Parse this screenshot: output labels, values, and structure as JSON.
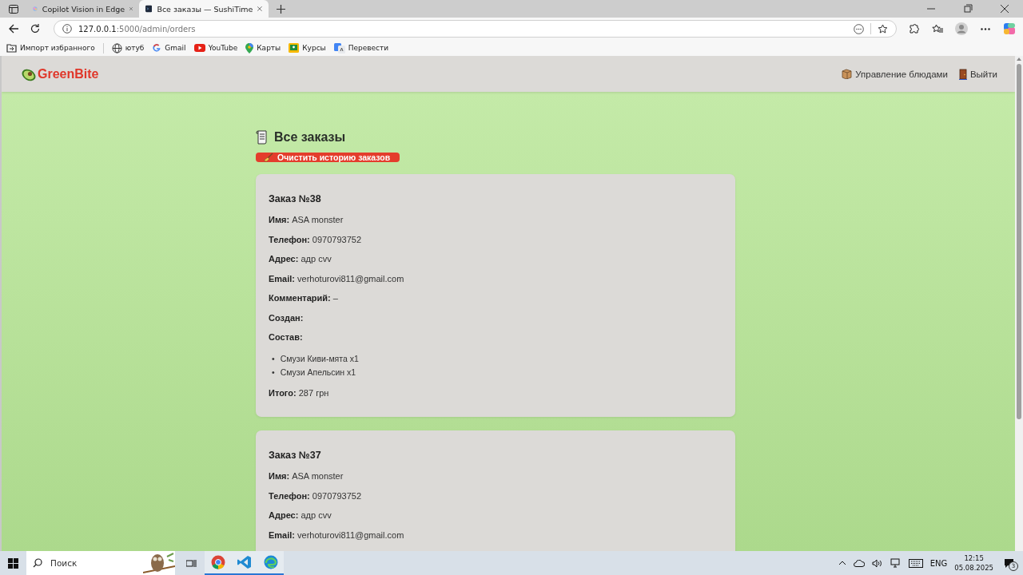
{
  "browser": {
    "tabs": [
      {
        "title": "Copilot Vision in Edge",
        "selected": false
      },
      {
        "title": "Все заказы — SushiTime",
        "selected": true
      }
    ],
    "address": {
      "host": "127.0.0.1",
      "path": ":5000/admin/orders"
    },
    "bookmarks": [
      {
        "label": "Импорт избранного",
        "kind": "import"
      },
      {
        "label": "ютуб",
        "kind": "globe"
      },
      {
        "label": "Gmail",
        "kind": "google"
      },
      {
        "label": "YouTube",
        "kind": "youtube"
      },
      {
        "label": "Карты",
        "kind": "maps"
      },
      {
        "label": "Курсы",
        "kind": "courses"
      },
      {
        "label": "Перевести",
        "kind": "translate"
      }
    ]
  },
  "site": {
    "logo": "GreenBite",
    "nav": [
      {
        "label": "Управление блюдами",
        "kind": "dishes"
      },
      {
        "label": "Выйти",
        "kind": "logout"
      }
    ]
  },
  "page": {
    "title": "Все заказы",
    "clear_button": "Очистить историю заказов",
    "orders": [
      {
        "title": "Заказ №38",
        "fields": [
          {
            "label": "Имя:",
            "value": "ASA monster"
          },
          {
            "label": "Телефон:",
            "value": "0970793752"
          },
          {
            "label": "Адрес:",
            "value": "адр cvv"
          },
          {
            "label": "Email:",
            "value": "verhoturovi811@gmail.com"
          },
          {
            "label": "Комментарий:",
            "value": "–"
          },
          {
            "label": "Создан:"
          }
        ],
        "composition_label": "Состав:",
        "items": [
          {
            "marker": "•",
            "text": "Смузи Киви-мята x1"
          },
          {
            "marker": "•",
            "text": "Смузи Апельсин x1"
          }
        ],
        "total": {
          "label": "Итого:",
          "value": "287 грн"
        }
      },
      {
        "title": "Заказ №37",
        "fields": [
          {
            "label": "Имя:",
            "value": "ASA monster"
          },
          {
            "label": "Телефон:",
            "value": "0970793752"
          },
          {
            "label": "Адрес:",
            "value": "адр cvv"
          },
          {
            "label": "Email:",
            "value": "verhoturovi811@gmail.com"
          }
        ]
      }
    ]
  },
  "taskbar": {
    "search_placeholder": "Поиск",
    "language": "ENG",
    "time": "12:15",
    "date": "05.08.2025",
    "notifications": "3"
  }
}
